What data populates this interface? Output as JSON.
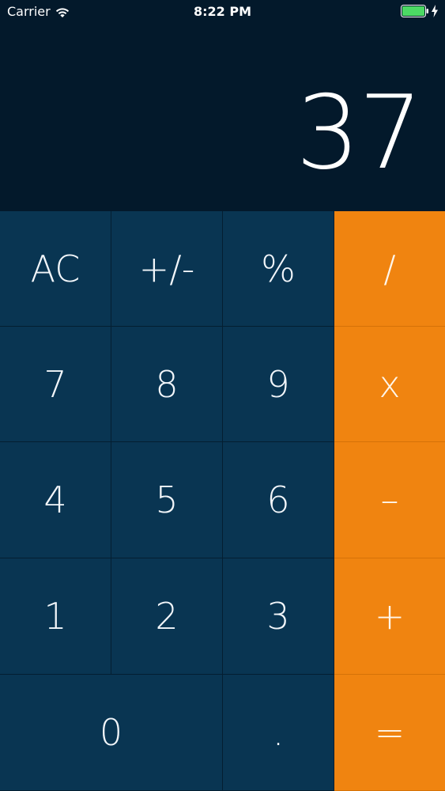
{
  "status_bar": {
    "carrier": "Carrier",
    "time": "8:22 PM",
    "battery_color": "#4cd964"
  },
  "display": {
    "value": "37"
  },
  "keys": {
    "clear": "AC",
    "sign": "+/-",
    "percent": "%",
    "divide": "/",
    "seven": "7",
    "eight": "8",
    "nine": "9",
    "multiply": "x",
    "four": "4",
    "five": "5",
    "six": "6",
    "subtract": "–",
    "one": "1",
    "two": "2",
    "three": "3",
    "add": "+",
    "zero": "0",
    "decimal": ".",
    "equals": "="
  },
  "colors": {
    "background": "#03192b",
    "key": "#093552",
    "operator": "#f08410"
  }
}
